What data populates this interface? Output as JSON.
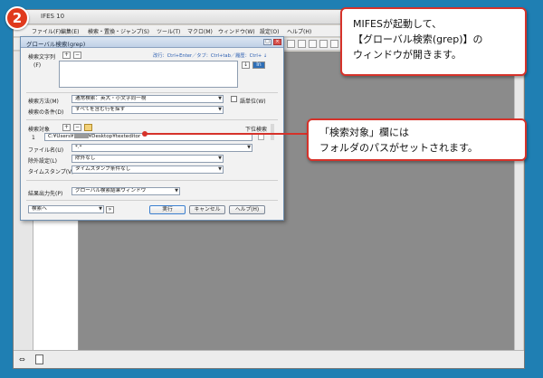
{
  "step_badge": "2",
  "mifes": {
    "title": "IFES 10",
    "menu": [
      "ファイル(F)",
      "編集(E)",
      "検索・置換・ジャンプ(S)",
      "ツール(T)",
      "マクロ(M)",
      "ウィンドウ(W)",
      "設定(O)",
      "ヘルプ(H)"
    ]
  },
  "dialog": {
    "title": "グローバル検索(grep)",
    "search_string_label": "検索文字列",
    "search_string_sub_label": "(F)",
    "search_string_hint": "改行：Ctrl+Enter／タブ：Ctrl+tab／履歴：Ctrl+ ↓",
    "search_method_label": "検索方法(M)",
    "search_method_value": "通常検索：英大・小文字同一視",
    "whole_word_label": "語単位(W)",
    "search_condition_label": "検索の条件(D)",
    "search_condition_value": "すべてを含む行を探す",
    "target_label": "検索対象",
    "subfolder_label": "下位検索",
    "target_row_number": "1",
    "target_path_prefix": "C:¥Users¥",
    "target_path_suffix": "¥Desktop¥texteditor",
    "filename_label": "ファイル名(U)",
    "filename_value": "*.*",
    "exclude_label": "除外設定(L)",
    "exclude_value": "除外なし",
    "timestamp_label": "タイムスタンプ(V)",
    "timestamp_value": "タイムスタンプ条件なし",
    "output_label": "結果出力先(P)",
    "output_value": "グローバル検索結果ウィンドウ",
    "search_to_value": "検索へ",
    "execute_label": "実行",
    "cancel_label": "キャンセル",
    "help_label": "ヘルプ(H)"
  },
  "callout_top": {
    "lines": [
      "MIFESが起動して、",
      "【グローバル検索(grep)】の",
      "ウィンドウが開きます。"
    ]
  },
  "callout_mid": {
    "lines": [
      "「検索対象」欄には",
      "フォルダのパスがセットされます。"
    ]
  },
  "colors": {
    "background": "#1f7fb3",
    "accent_red": "#d6322a",
    "badge_red": "#e03a1d"
  }
}
